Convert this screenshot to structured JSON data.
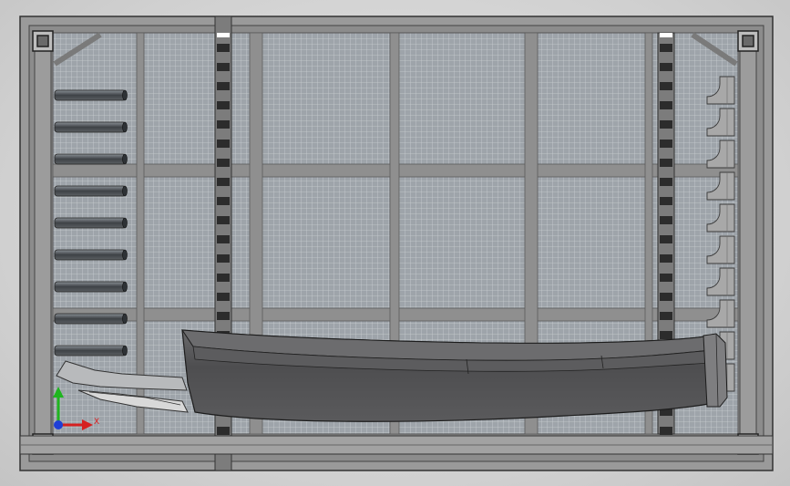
{
  "viewport": {
    "type": "cad-3d-view",
    "background": "#d4d4d4"
  },
  "model": {
    "frame_color": "#8a8a8a",
    "frame_dark": "#3c3c3c",
    "mesh_color": "#9aa0a6",
    "hull_color": "#505052",
    "hull_top_color": "#6e6e70",
    "tube_color": "#4a4e52",
    "roller_count": 9,
    "bracket_count": 10
  },
  "triad": {
    "x_label": "X",
    "x_color": "#d62020",
    "y_color": "#1fb51f",
    "z_color": "#1f3fd6"
  }
}
